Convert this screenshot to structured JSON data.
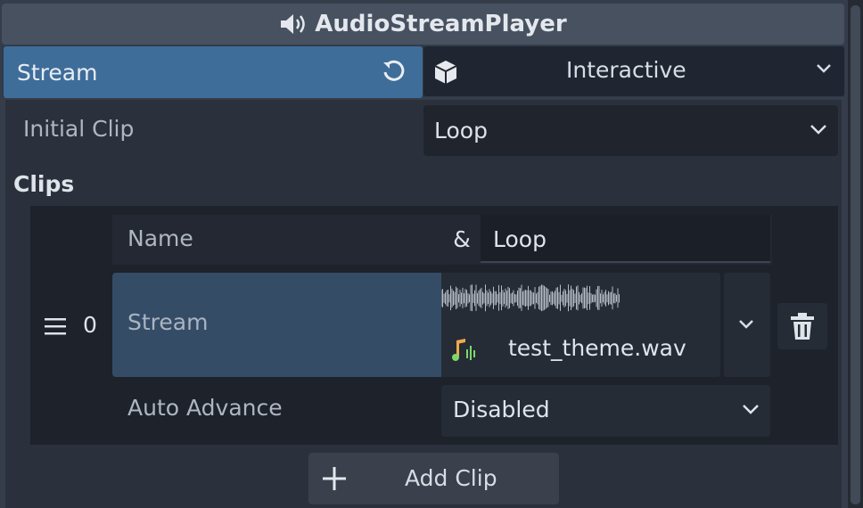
{
  "header": {
    "title": "AudioStreamPlayer",
    "icon": "speaker-icon"
  },
  "stream_property": {
    "label": "Stream",
    "revert_icon": "revert-icon",
    "value": "Interactive",
    "value_icon": "cube-icon"
  },
  "initial_clip": {
    "label": "Initial Clip",
    "value": "Loop"
  },
  "clips": {
    "title": "Clips",
    "items": [
      {
        "index": "0",
        "name_label": "Name",
        "name_prefix": "&",
        "name_value": "Loop",
        "stream_label": "Stream",
        "stream_file": "test_theme.wav",
        "auto_advance_label": "Auto Advance",
        "auto_advance_value": "Disabled"
      }
    ],
    "add_button": "Add Clip"
  },
  "colors": {
    "accent": "#3f6d9a",
    "background": "#363d4a",
    "panel": "#2b313c"
  }
}
